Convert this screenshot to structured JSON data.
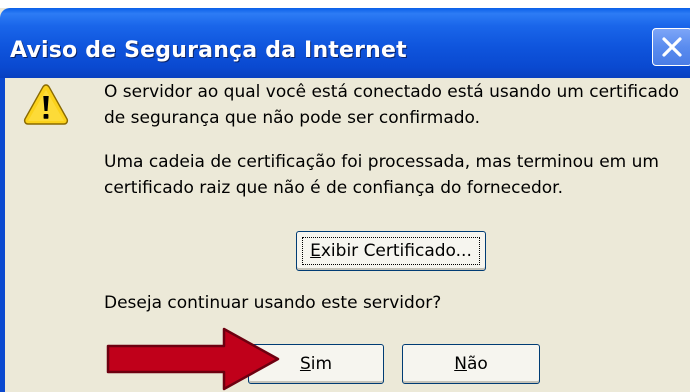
{
  "window": {
    "title": "Aviso de Segurança da Internet",
    "close_icon": "close-icon"
  },
  "message": {
    "icon": "warning-icon",
    "line1": "O servidor ao qual você está conectado está usando um certificado",
    "line2": "de segurança que não pode ser confirmado.",
    "line3": "Uma cadeia de certificação foi processada, mas terminou em um",
    "line4": "certificado raiz que não é de confiança do fornecedor.",
    "question": "Deseja continuar usando este servidor?"
  },
  "buttons": {
    "view_cert": {
      "accesskey": "E",
      "rest": "xibir Certificado..."
    },
    "yes": {
      "accesskey": "S",
      "rest": "im"
    },
    "no": {
      "accesskey": "N",
      "rest": "ão"
    }
  },
  "annotation": {
    "arrow_color": "#c0001a",
    "arrow_icon": "arrow-right-icon"
  }
}
